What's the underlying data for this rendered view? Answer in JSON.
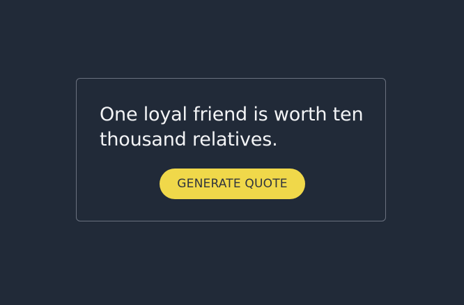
{
  "quote": {
    "text": "One loyal friend is worth ten thousand relatives."
  },
  "actions": {
    "generate_label": "GENERATE QUOTE"
  },
  "colors": {
    "background": "#212a38",
    "card_border": "#6b7280",
    "text": "#f3f4f6",
    "button": "#f0d84a",
    "button_text": "#2f343d"
  }
}
